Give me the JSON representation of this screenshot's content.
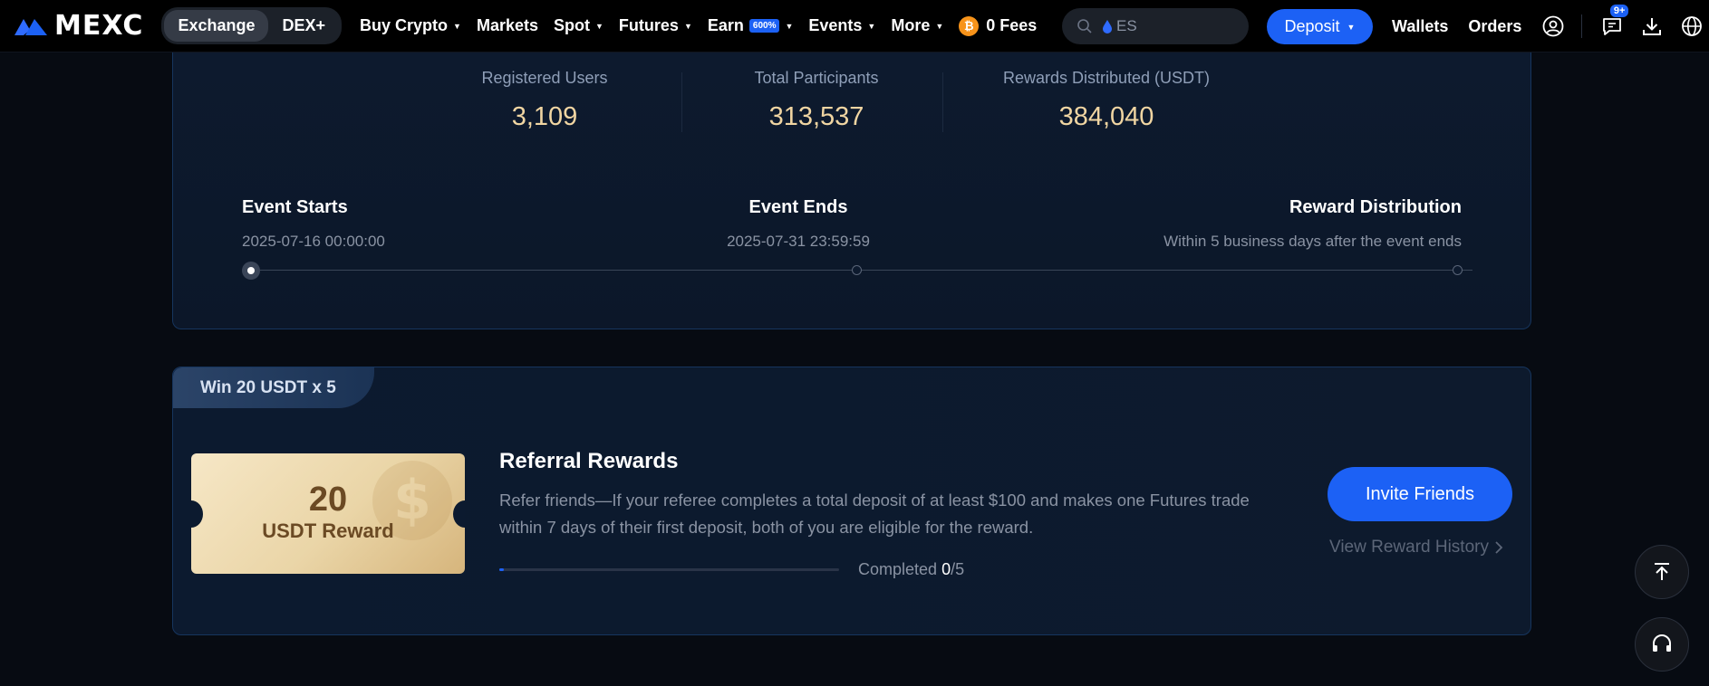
{
  "nav": {
    "logo_text": "MEXC",
    "segments": [
      {
        "label": "Exchange",
        "active": true
      },
      {
        "label": "DEX+",
        "active": false
      }
    ],
    "items": [
      {
        "label": "Buy Crypto",
        "dropdown": true
      },
      {
        "label": "Markets",
        "dropdown": false
      },
      {
        "label": "Spot",
        "dropdown": true
      },
      {
        "label": "Futures",
        "dropdown": true
      },
      {
        "label": "Earn",
        "badge": "600%",
        "dropdown": true
      },
      {
        "label": "Events",
        "dropdown": true
      },
      {
        "label": "More",
        "dropdown": true
      }
    ],
    "fees_coin": "₿",
    "fees_label": "0 Fees",
    "search_value": "ES",
    "deposit_label": "Deposit",
    "wallets_label": "Wallets",
    "orders_label": "Orders",
    "notification_badge": "9+",
    "icons": [
      "user-icon",
      "message-icon",
      "download-icon",
      "globe-icon"
    ]
  },
  "stats": {
    "registered_users_label": "Registered Users",
    "registered_users_value": "3,109",
    "total_participants_label": "Total Participants",
    "total_participants_value": "313,537",
    "rewards_distributed_label": "Rewards Distributed (USDT)",
    "rewards_distributed_value": "384,040"
  },
  "timeline": {
    "start_title": "Event Starts",
    "start_value": "2025-07-16 00:00:00",
    "end_title": "Event Ends",
    "end_value": "2025-07-31 23:59:59",
    "reward_title": "Reward Distribution",
    "reward_value": "Within 5 business days after the event ends",
    "active_step": 0
  },
  "referral": {
    "tab_label": "Win 20 USDT x 5",
    "ticket_amount": "20",
    "ticket_label": "USDT Reward",
    "title": "Referral Rewards",
    "description": "Refer friends—If your referee completes a total deposit of at least $100 and makes one Futures trade within 7 days of their first deposit, both of you are eligible for the reward.",
    "progress_label": "Completed",
    "progress_current": "0",
    "progress_total": "/5",
    "progress_fraction": 0,
    "invite_label": "Invite Friends",
    "history_label": "View Reward History"
  },
  "colors": {
    "accent": "#1c61f5",
    "gold_value": "#f0d5a2",
    "card_bg": "#0c1a2f",
    "page_bg": "#070b12"
  }
}
